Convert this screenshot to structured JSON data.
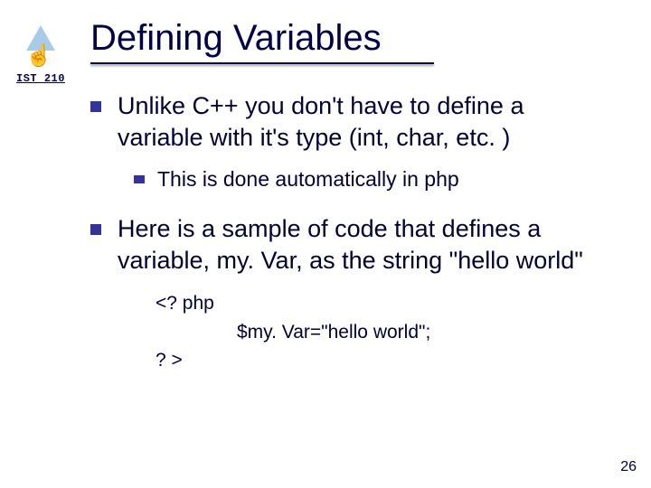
{
  "course": {
    "code": "IST 210"
  },
  "title": "Defining Variables",
  "bullets": {
    "b1": "Unlike C++ you don't have to define a variable with it's type (int, char, etc. )",
    "b1_sub": "This is done automatically in php",
    "b2": "Here is a sample of code that defines a variable, my. Var, as the string \"hello world\""
  },
  "code": {
    "line1": "<? php",
    "line2": "$my. Var=\"hello world\";",
    "line3": "? >"
  },
  "page_number": "26"
}
